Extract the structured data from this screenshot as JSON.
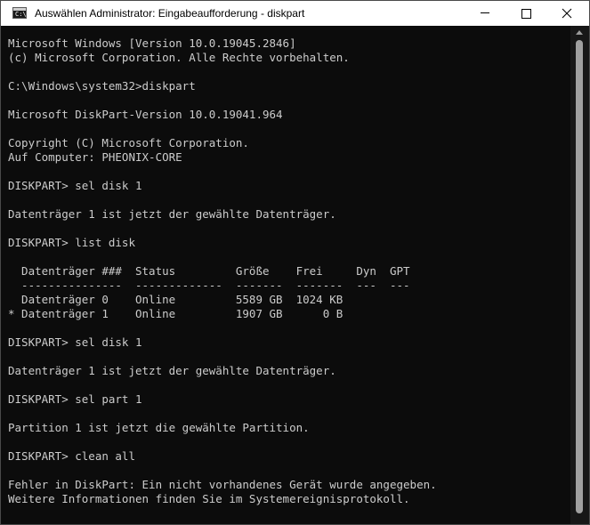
{
  "window": {
    "title": "Auswählen Administrator: Eingabeaufforderung - diskpart",
    "icon": "cmd-icon",
    "controls": [
      "minimize",
      "maximize",
      "close"
    ]
  },
  "console": {
    "lines": [
      "Microsoft Windows [Version 10.0.19045.2846]",
      "(c) Microsoft Corporation. Alle Rechte vorbehalten.",
      "",
      "C:\\Windows\\system32>diskpart",
      "",
      "Microsoft DiskPart-Version 10.0.19041.964",
      "",
      "Copyright (C) Microsoft Corporation.",
      "Auf Computer: PHEONIX-CORE",
      "",
      "DISKPART> sel disk 1",
      "",
      "Datenträger 1 ist jetzt der gewählte Datenträger.",
      "",
      "DISKPART> list disk",
      "",
      "  Datenträger ###  Status         Größe    Frei     Dyn  GPT",
      "  ---------------  -------------  -------  -------  ---  ---",
      "  Datenträger 0    Online         5589 GB  1024 KB",
      "* Datenträger 1    Online         1907 GB      0 B",
      "",
      "DISKPART> sel disk 1",
      "",
      "Datenträger 1 ist jetzt der gewählte Datenträger.",
      "",
      "DISKPART> sel part 1",
      "",
      "Partition 1 ist jetzt die gewählte Partition.",
      "",
      "DISKPART> clean all",
      "",
      "Fehler in DiskPart: Ein nicht vorhandenes Gerät wurde angegeben.",
      "Weitere Informationen finden Sie im Systemereignisprotokoll."
    ]
  },
  "colors": {
    "background": "#0c0c0c",
    "text": "#cccccc",
    "titlebar": "#ffffff"
  }
}
